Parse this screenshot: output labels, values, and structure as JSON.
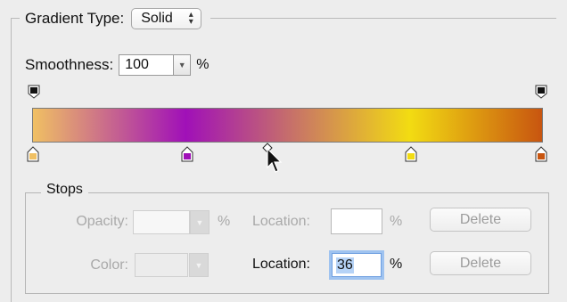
{
  "gradient_type": {
    "label": "Gradient Type:",
    "value": "Solid"
  },
  "smoothness": {
    "label": "Smoothness:",
    "value": "100",
    "unit": "%"
  },
  "gradient": {
    "colors": [
      "#f0c063",
      "#a010b8",
      "#f2dc12",
      "#c85510"
    ],
    "color_stops": [
      {
        "color": "#f0c063",
        "location": 0
      },
      {
        "color": "#a010b8",
        "location": 30
      },
      {
        "color": "#f2dc12",
        "location": 74
      },
      {
        "color": "#c85510",
        "location": 100
      }
    ],
    "opacity_stops": [
      0,
      100
    ],
    "midpoint_location": 46
  },
  "stops": {
    "legend": "Stops",
    "opacity_label": "Opacity:",
    "opacity_value": "",
    "opacity_unit": "%",
    "opacity_location_label": "Location:",
    "opacity_location_value": "",
    "opacity_location_unit": "%",
    "opacity_delete_label": "Delete",
    "color_label": "Color:",
    "color_location_label": "Location:",
    "color_location_value": "36",
    "color_location_unit": "%",
    "color_delete_label": "Delete"
  }
}
